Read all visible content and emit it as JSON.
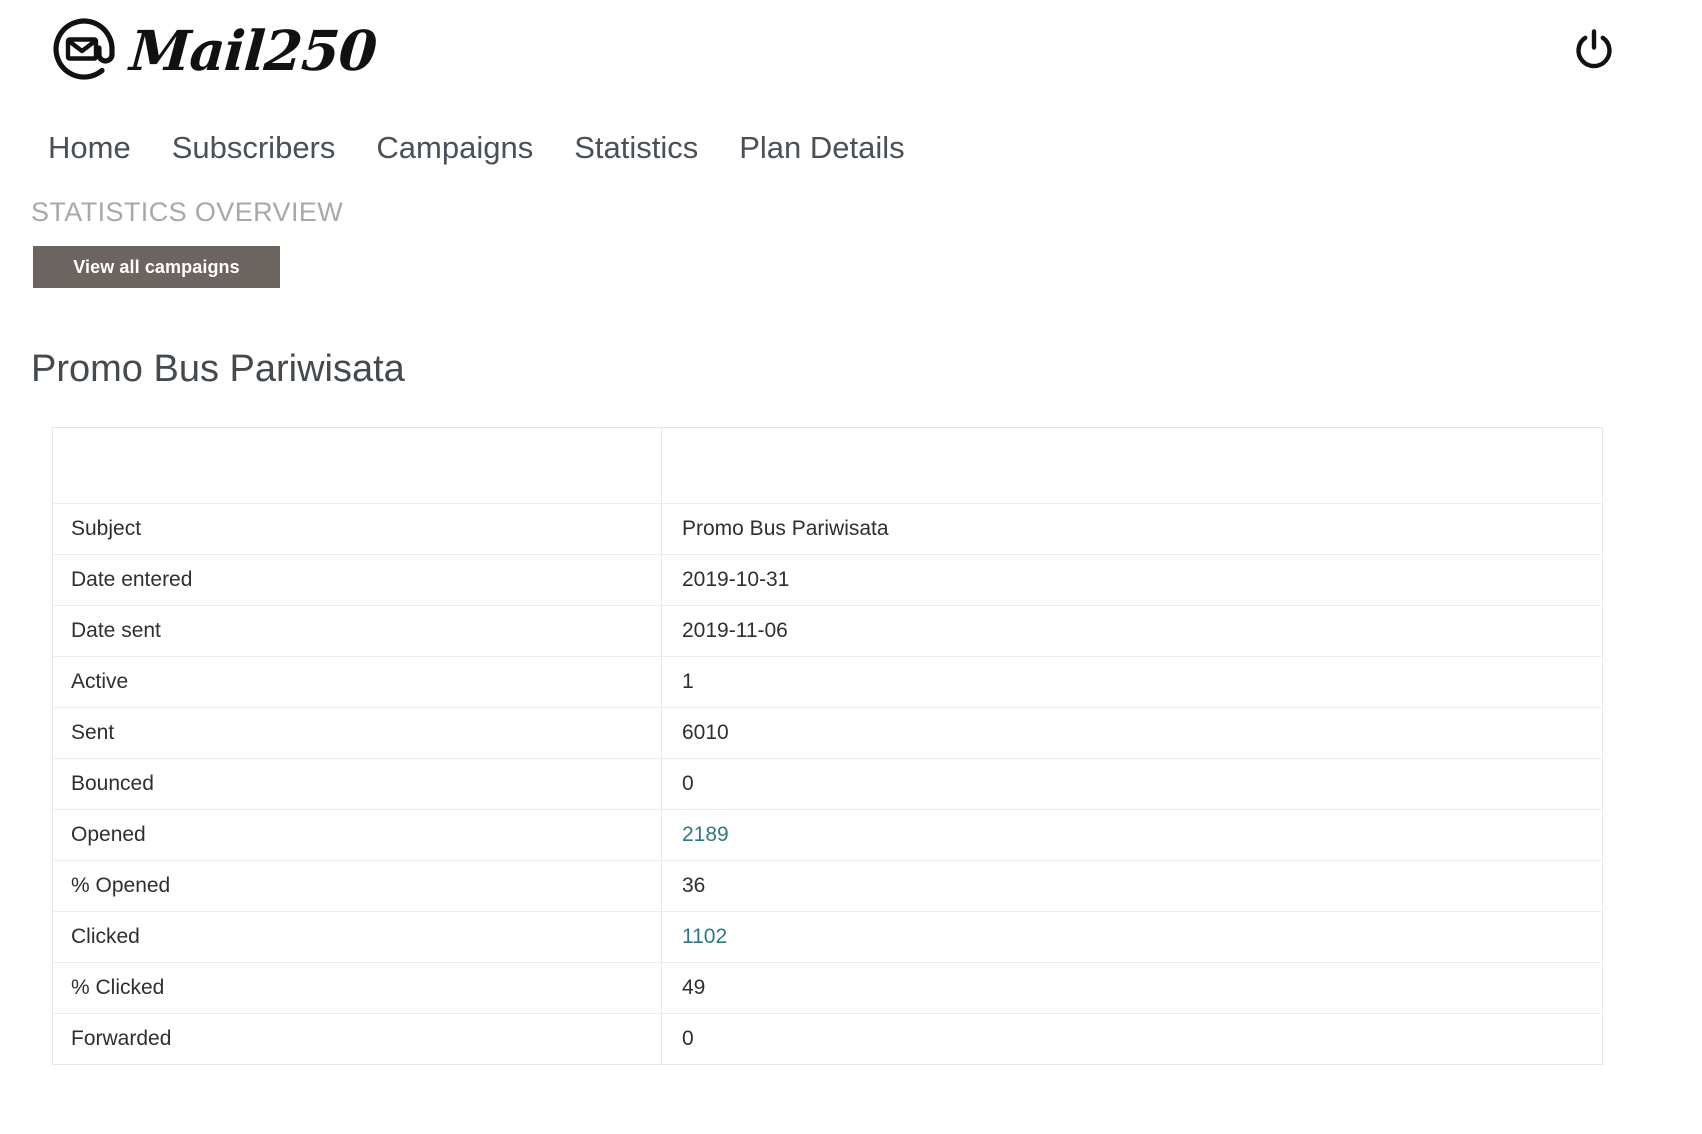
{
  "brand": {
    "logo_icon": "at-envelope-icon",
    "wordmark": "Mail250"
  },
  "header": {
    "logout_icon": "power-icon"
  },
  "nav": {
    "items": [
      {
        "label": "Home"
      },
      {
        "label": "Subscribers"
      },
      {
        "label": "Campaigns"
      },
      {
        "label": "Statistics"
      },
      {
        "label": "Plan Details"
      }
    ]
  },
  "page": {
    "section_title": "STATISTICS OVERVIEW",
    "view_all_button": "View all campaigns",
    "campaign_heading": "Promo Bus Pariwisata"
  },
  "colors": {
    "button_bg": "#6c6460",
    "link_teal": "#2d7b82",
    "section_title_gray": "#a8a8a8",
    "nav_text": "#4a5056",
    "heading_text": "#454a4f",
    "table_border": "#e6e6e6"
  },
  "stats_table": {
    "headers": [
      "",
      ""
    ],
    "rows": [
      {
        "label": "Subject",
        "value": "Promo Bus Pariwisata",
        "link": false
      },
      {
        "label": "Date entered",
        "value": "2019-10-31",
        "link": false
      },
      {
        "label": "Date sent",
        "value": "2019-11-06",
        "link": false
      },
      {
        "label": "Active",
        "value": "1",
        "link": false
      },
      {
        "label": "Sent",
        "value": "6010",
        "link": false
      },
      {
        "label": "Bounced",
        "value": "0",
        "link": false
      },
      {
        "label": "Opened",
        "value": "2189",
        "link": true
      },
      {
        "label": "% Opened",
        "value": "36",
        "link": false
      },
      {
        "label": "Clicked",
        "value": "1102",
        "link": true
      },
      {
        "label": "% Clicked",
        "value": "49",
        "link": false
      },
      {
        "label": "Forwarded",
        "value": "0",
        "link": false
      }
    ]
  }
}
